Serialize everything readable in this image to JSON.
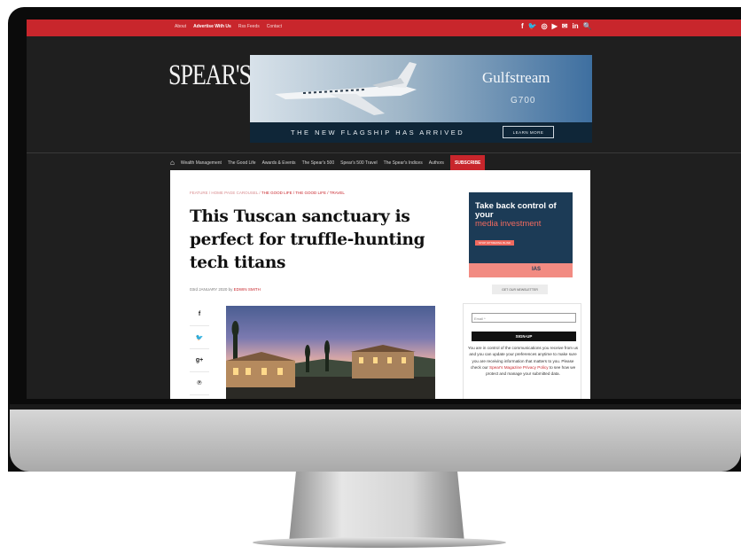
{
  "topbar": {
    "links": [
      "About",
      "Advertise With Us",
      "Rss Feeds",
      "Contact"
    ],
    "social_icons": [
      "facebook-icon",
      "twitter-icon",
      "instagram-icon",
      "youtube-icon",
      "email-icon",
      "linkedin-icon",
      "search-icon"
    ],
    "social_glyphs": [
      "f",
      "🐦",
      "◎",
      "▶",
      "✉",
      "in",
      "🔍"
    ]
  },
  "logo": "SPEAR'S",
  "banner_ad": {
    "brand": "Gulfstream",
    "model": "G700",
    "tagline": "THE NEW FLAGSHIP HAS ARRIVED",
    "cta": "LEARN MORE"
  },
  "main_nav": {
    "items": [
      "Wealth Management",
      "The Good Life",
      "Awards & Events",
      "The Spear's 500",
      "Spear's 500 Travel",
      "The Spear's Indices",
      "Authors"
    ],
    "subscribe": "SUBSCRIBE"
  },
  "article": {
    "breadcrumb_plain": "FEATURE / HOME PAGE CAROUSEL / ",
    "breadcrumb_links": "THE GOOD LIFE / THE GOOD LIFE / TRAVEL",
    "headline": "This Tuscan sanctuary is perfect for truffle-hunting tech titans",
    "date": "03rd JANUARY 2020 by ",
    "author": "EDWIN SMITH"
  },
  "share_icons": [
    {
      "name": "facebook-icon",
      "glyph": "f"
    },
    {
      "name": "twitter-icon",
      "glyph": "🐦"
    },
    {
      "name": "google-plus-icon",
      "glyph": "g+"
    },
    {
      "name": "pinterest-icon",
      "glyph": "℗"
    }
  ],
  "sidebar_ad": {
    "line1": "Take back control of your",
    "line2": "media investment",
    "cta": "STOP OPTIMIZING BLIND",
    "brand": "IAS"
  },
  "newsletter_button": "GET OUR NEWSLETTER",
  "signup": {
    "email_placeholder": "Email *",
    "button": "SIGN-UP",
    "legal_1": "You are in control of the communications you receive from us and you can update your preferences anytime to make sure you are receiving information that matters to you. Please check our ",
    "legal_link": "Spear's Magazine Privacy Policy",
    "legal_2": " to see how we protect and manage your submitted data."
  },
  "colors": {
    "brand_red": "#c8262c",
    "ad_navy": "#0f2638",
    "sidebar_ad_bg": "#1c3b56",
    "sidebar_ad_accent": "#f06a5f"
  }
}
